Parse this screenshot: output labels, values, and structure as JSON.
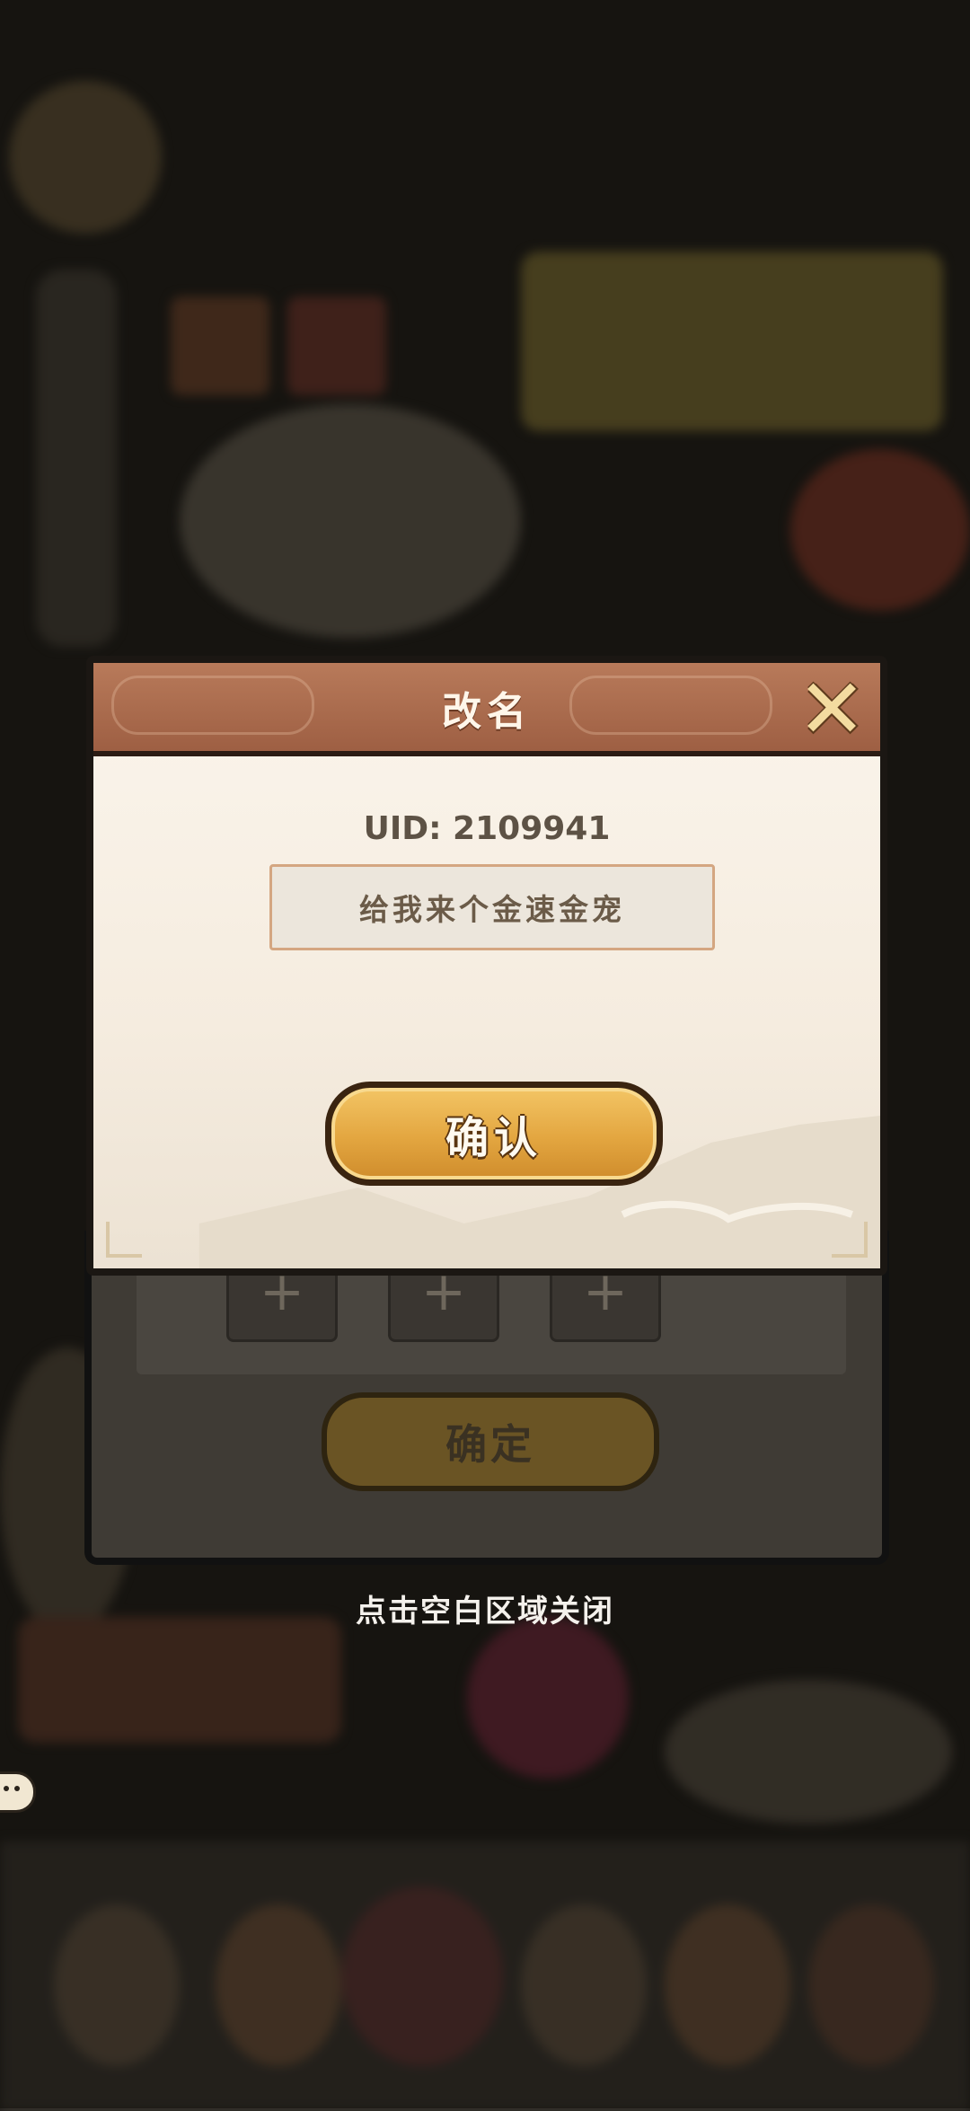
{
  "rename_dialog": {
    "title": "改名",
    "uid_text": "UID: 2109941",
    "name_value": "给我来个金速金宠",
    "confirm_label": "确认"
  },
  "back_dialog": {
    "ok_label": "确定",
    "slot_symbol": "+"
  },
  "close_hint": "点击空白区域关闭",
  "colors": {
    "title_bar": "#a86a4c",
    "dialog_bg": "#f8f1e6",
    "confirm_button": "#e6ab45",
    "dim_overlay": "#1f1d19"
  },
  "icons": {
    "close": "close-x-icon",
    "chat": "chat-bubble-icon"
  }
}
